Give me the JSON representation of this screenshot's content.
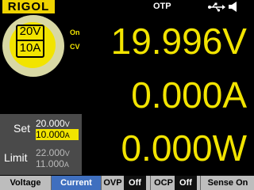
{
  "header": {
    "logo": "RIGOL",
    "status": "OTP",
    "icons": [
      "usb-icon",
      "speaker-icon"
    ]
  },
  "range": {
    "voltage": "20V",
    "current": "10A"
  },
  "output": {
    "on": "On",
    "mode": "CV"
  },
  "readings": {
    "voltage": "19.996V",
    "current": "0.000A",
    "power": "0.000W"
  },
  "set": {
    "label": "Set",
    "voltage": "20.000",
    "voltage_unit": "V",
    "current": "10.000",
    "current_unit": "A"
  },
  "limit": {
    "label": "Limit",
    "voltage": "22.000",
    "voltage_unit": "V",
    "current": "11.000",
    "current_unit": "A"
  },
  "menu": {
    "voltage": "Voltage",
    "current": "Current",
    "ovp": "OVP",
    "ovp_state": "Off",
    "ocp": "OCP",
    "ocp_state": "Off",
    "sense": "Sense On"
  },
  "colors": {
    "accent": "#f2e400",
    "selected": "#3f6fbf",
    "panel": "#4a4a4a"
  }
}
